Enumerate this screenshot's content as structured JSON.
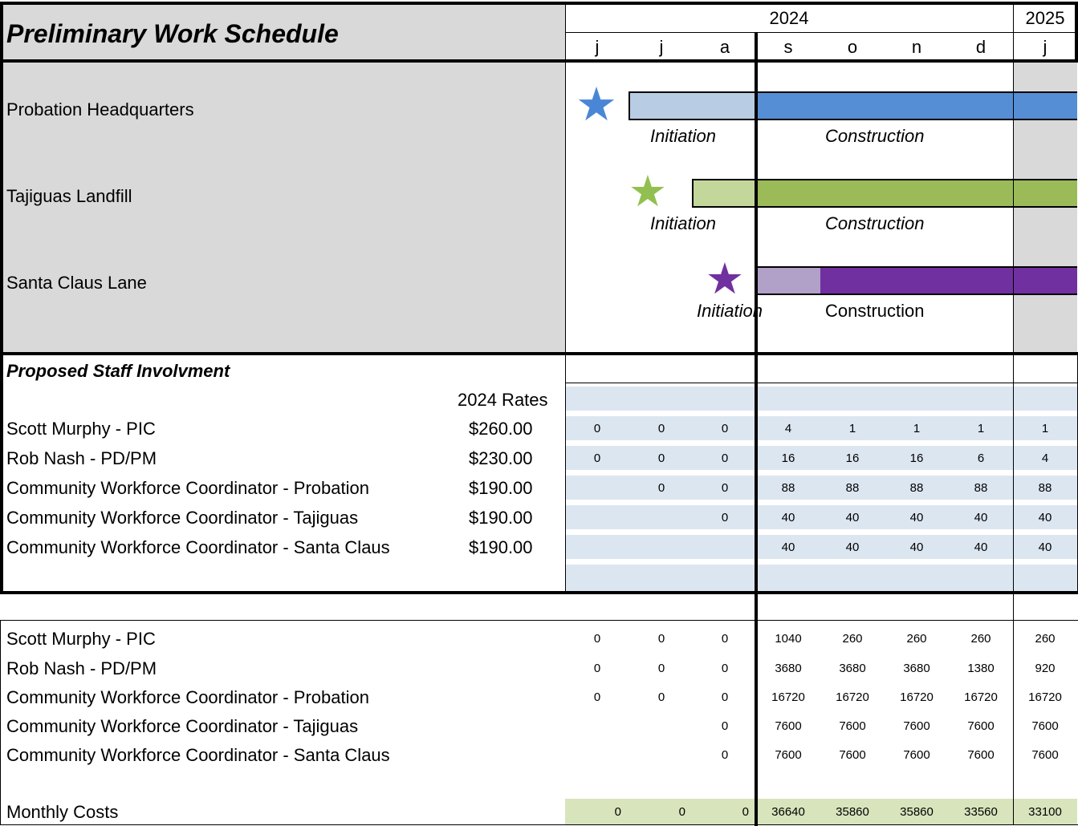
{
  "header": {
    "title": "Preliminary Work Schedule",
    "years": [
      "2024",
      "2025"
    ],
    "months": [
      "j",
      "j",
      "a",
      "s",
      "o",
      "n",
      "d",
      "j"
    ]
  },
  "projects": [
    {
      "name": "Probation Headquarters",
      "initiation_label": "Initiation",
      "construction_label": "Construction",
      "star_color": "#4a86d6",
      "init_color": "#b8cce4",
      "construction_color": "#558ed5"
    },
    {
      "name": "Tajiguas Landfill",
      "initiation_label": "Initiation",
      "construction_label": "Construction",
      "star_color": "#92c050",
      "init_color": "#c4d79b",
      "construction_color": "#9bbb59"
    },
    {
      "name": "Santa Claus Lane",
      "initiation_label": "Initiation",
      "construction_label": "Construction",
      "star_color": "#7030a0",
      "init_color": "#b1a0c7",
      "construction_color": "#7030a0"
    }
  ],
  "staff": {
    "heading": "Proposed Staff Involvment",
    "rates_header": "2024 Rates",
    "rows": [
      {
        "name": "Scott Murphy - PIC",
        "rate": "$260.00",
        "hours": [
          "0",
          "0",
          "0",
          "4",
          "1",
          "1",
          "1",
          "1"
        ]
      },
      {
        "name": "Rob Nash - PD/PM",
        "rate": "$230.00",
        "hours": [
          "0",
          "0",
          "0",
          "16",
          "16",
          "16",
          "6",
          "4"
        ]
      },
      {
        "name": "Community Workforce Coordinator - Probation",
        "rate": "$190.00",
        "hours": [
          "",
          "0",
          "0",
          "88",
          "88",
          "88",
          "88",
          "88"
        ]
      },
      {
        "name": "Community Workforce Coordinator - Tajiguas",
        "rate": "$190.00",
        "hours": [
          "",
          "",
          "0",
          "40",
          "40",
          "40",
          "40",
          "40"
        ]
      },
      {
        "name": "Community Workforce Coordinator - Santa Claus",
        "rate": "$190.00",
        "hours": [
          "",
          "",
          "",
          "40",
          "40",
          "40",
          "40",
          "40"
        ]
      }
    ]
  },
  "costs": {
    "rows": [
      {
        "name": "Scott Murphy - PIC",
        "values": [
          "0",
          "0",
          "0",
          "1040",
          "260",
          "260",
          "260",
          "260"
        ]
      },
      {
        "name": "Rob Nash - PD/PM",
        "values": [
          "0",
          "0",
          "0",
          "3680",
          "3680",
          "3680",
          "1380",
          "920"
        ]
      },
      {
        "name": "Community Workforce Coordinator - Probation",
        "values": [
          "0",
          "0",
          "0",
          "16720",
          "16720",
          "16720",
          "16720",
          "16720"
        ]
      },
      {
        "name": "Community Workforce Coordinator - Tajiguas",
        "values": [
          "",
          "",
          "0",
          "7600",
          "7600",
          "7600",
          "7600",
          "7600"
        ]
      },
      {
        "name": "Community Workforce Coordinator - Santa Claus",
        "values": [
          "",
          "",
          "0",
          "7600",
          "7600",
          "7600",
          "7600",
          "7600"
        ]
      }
    ],
    "total": {
      "name": "Monthly Costs",
      "values": [
        "0",
        "0",
        "0",
        "36640",
        "35860",
        "35860",
        "33560",
        "33100"
      ]
    },
    "total_color": "#d8e4bc"
  },
  "colors": {
    "gray_panel": "#d9d9d9",
    "grid_fill": "#dce6f1"
  }
}
